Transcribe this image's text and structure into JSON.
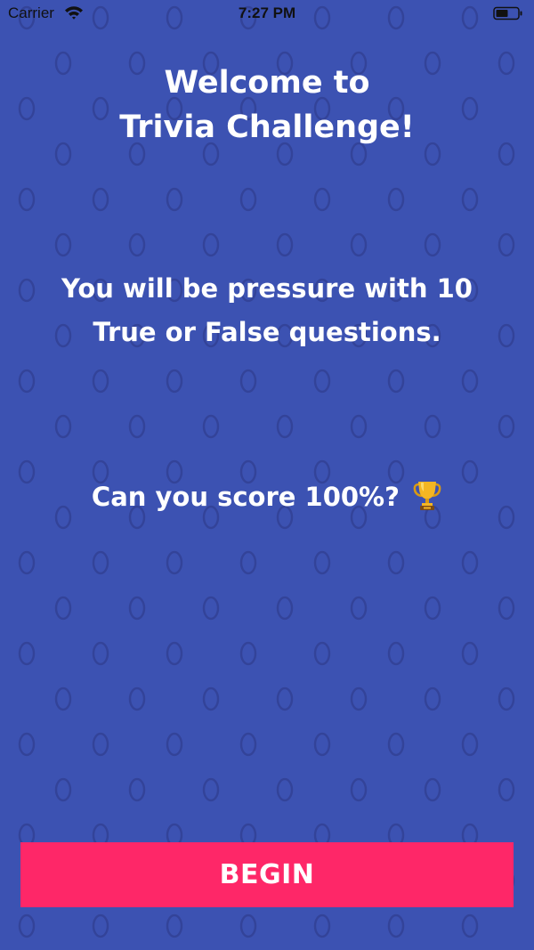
{
  "status_bar": {
    "carrier": "Carrier",
    "time": "7:27 PM"
  },
  "title": {
    "line1": "Welcome to",
    "line2": "Trivia Challenge!"
  },
  "rules": {
    "line1": "You will be pressure with 10",
    "line2": "True or False questions."
  },
  "challenge": {
    "text": "Can you score 100%?",
    "icon": "trophy-icon"
  },
  "begin_button": {
    "label": "BEGIN"
  },
  "colors": {
    "background": "#3c52b2",
    "pattern": "#334399",
    "button": "#fe2768",
    "text": "#ffffff"
  }
}
